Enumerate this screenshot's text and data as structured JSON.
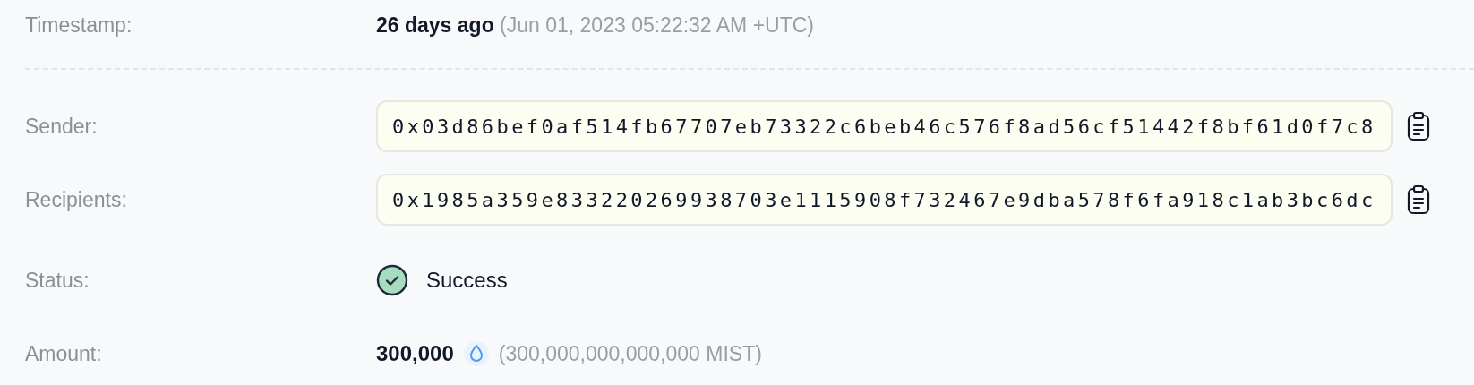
{
  "rows": [
    {
      "kind": "timestamp",
      "label": "Timestamp:",
      "value": "26 days ago",
      "detail": "(Jun 01, 2023 05:22:32 AM +UTC)"
    },
    {
      "kind": "divider"
    },
    {
      "kind": "address",
      "label": "Sender:",
      "value": "0x03d86bef0af514fb67707eb73322c6beb46c576f8ad56cf51442f8bf61d0f7c8"
    },
    {
      "kind": "address",
      "label": "Recipients:",
      "value": "0x1985a359e833220269938703e1115908f732467e9dba578f6fa918c1ab3bc6dc"
    },
    {
      "kind": "status",
      "label": "Status:",
      "value": "Success",
      "success": true
    },
    {
      "kind": "amount",
      "label": "Amount:",
      "value": "300,000",
      "detail": "(300,000,000,000,000 MIST)"
    }
  ]
}
